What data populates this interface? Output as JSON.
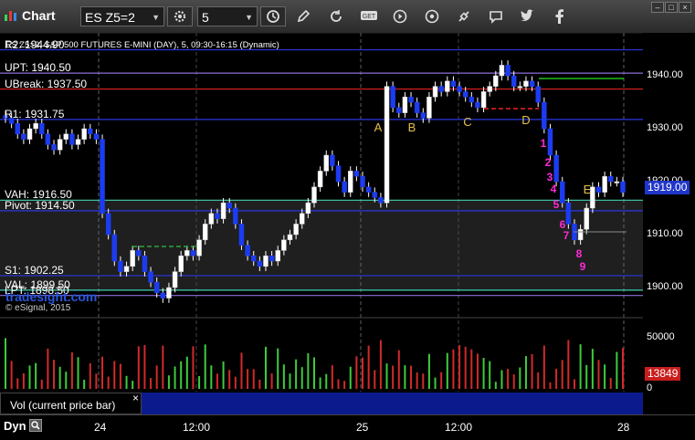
{
  "app": {
    "title": "Chart"
  },
  "toolbar": {
    "symbol": "ES Z5=2",
    "interval": "5"
  },
  "chart": {
    "title": "ES Z5=2, S&P 500 FUTURES E-MINI (DAY), 5, 09:30-16:15 (Dynamic)",
    "watermark": "tradesight.com",
    "copyright": "© eSignal, 2015",
    "current_price": "1919.00",
    "levels": [
      {
        "name": "R2: 1944.90",
        "value": 1944.9,
        "color": "#2b36e0"
      },
      {
        "name": "UPT: 1940.50",
        "value": 1940.5,
        "color": "#8b6fd8"
      },
      {
        "name": "UBreak: 1937.50",
        "value": 1937.5,
        "color": "#d01e1e"
      },
      {
        "name": "R1: 1931.75",
        "value": 1931.75,
        "color": "#2b36e0"
      },
      {
        "name": "VAH: 1916.50",
        "value": 1916.5,
        "color": "#3fd0b0"
      },
      {
        "name": "Pivot: 1914.50",
        "value": 1914.5,
        "color": "#2b36e0"
      },
      {
        "name": "S1: 1902.25",
        "value": 1902.25,
        "color": "#2b36e0"
      },
      {
        "name": "VAL: 1899.50",
        "value": 1899.5,
        "color": "#3fd0b0"
      },
      {
        "name": "LPT: 1898.50",
        "value": 1898.5,
        "color": "#8b6fd8"
      }
    ],
    "price_ticks": [
      "1940.00",
      "1930.00",
      "1920.00",
      "1910.00",
      "1900.00"
    ],
    "annotations_letters": [
      "A",
      "B",
      "C",
      "D",
      "E"
    ],
    "annotations_counts": [
      "1",
      "2",
      "3",
      "4",
      "5",
      "6",
      "7",
      "8",
      "9"
    ]
  },
  "volume": {
    "tab_label": "Vol (current price bar)",
    "close_glyph": "×",
    "ticks": [
      "50000",
      "0"
    ],
    "current_value": "13849"
  },
  "time_axis": {
    "dyn_label": "Dyn",
    "labels": [
      "24",
      "12:00",
      "25",
      "12:00",
      "28"
    ]
  },
  "chart_data": {
    "type": "candlestick",
    "symbol": "ES Z5=2",
    "ylim": [
      1896,
      1948
    ],
    "y_ticks": [
      1900,
      1910,
      1920,
      1930,
      1940
    ],
    "current": 1919.0,
    "sessions": [
      "24",
      "25",
      "28"
    ],
    "close_path": [
      1932,
      1931,
      1929,
      1928,
      1930,
      1931,
      1929,
      1927,
      1926,
      1928,
      1929,
      1927,
      1928,
      1930,
      1929,
      1928,
      1914,
      1910,
      1905,
      1903,
      1904,
      1907,
      1906,
      1903,
      1901,
      1899,
      1898,
      1900,
      1903,
      1906,
      1907,
      1906,
      1909,
      1912,
      1914,
      1913,
      1916,
      1915,
      1912,
      1908,
      1906,
      1905,
      1904,
      1906,
      1905,
      1907,
      1909,
      1910,
      1912,
      1914,
      1916,
      1919,
      1922,
      1925,
      1923,
      1920,
      1918,
      1922,
      1921,
      1919,
      1918,
      1917,
      1916,
      1938,
      1934,
      1933,
      1936,
      1935,
      1933,
      1932,
      1936,
      1938,
      1937,
      1939,
      1938,
      1937,
      1936,
      1935,
      1934,
      1937,
      1938,
      1940,
      1942,
      1940,
      1938,
      1938,
      1939,
      1938,
      1935,
      1930,
      1925,
      1920,
      1916,
      1912,
      1909,
      1911,
      1915,
      1919,
      1918,
      1921,
      1920,
      1920,
      1918
    ]
  }
}
